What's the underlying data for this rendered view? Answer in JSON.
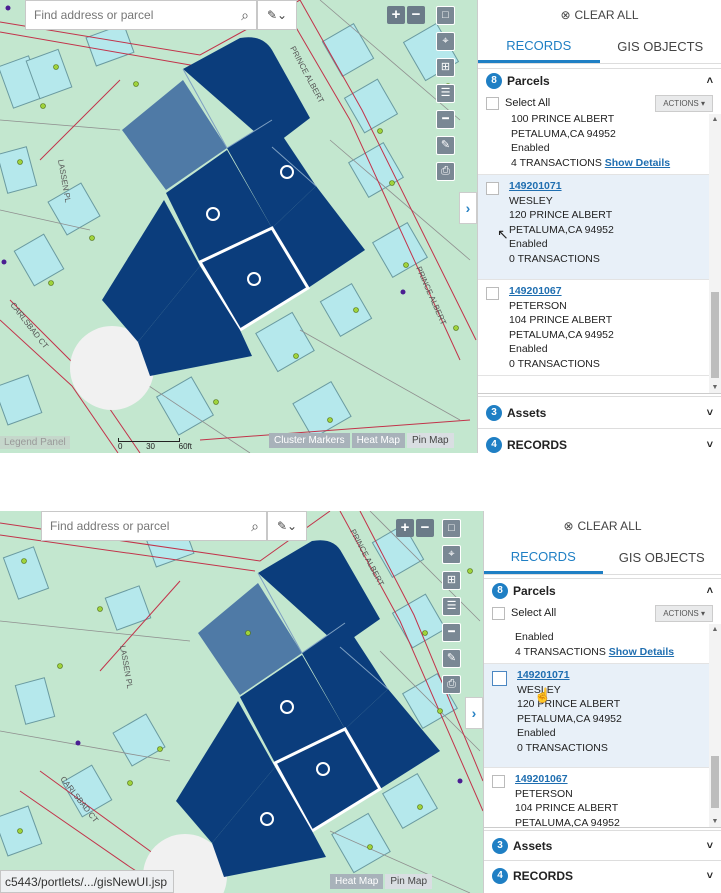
{
  "search": {
    "placeholder": "Find address or parcel"
  },
  "map": {
    "streets": [
      "LASSEN PL",
      "PRINCE ALBERT",
      "CARLSBAD CT"
    ],
    "legend_label": "Legend Panel",
    "scale": {
      "ticks": [
        "0",
        "30",
        "60ft"
      ]
    },
    "modes": [
      "Cluster Markers",
      "Heat Map",
      "Pin Map"
    ],
    "status_url": "c5443/portlets/.../gisNewUI.jsp"
  },
  "panel": {
    "clear_all": "CLEAR ALL",
    "tabs": [
      "RECORDS",
      "GIS OBJECTS"
    ],
    "parcels": {
      "count": "8",
      "label": "Parcels"
    },
    "select_all": "Select All",
    "actions": "ACTIONS",
    "assets": {
      "count": "3",
      "label": "Assets"
    },
    "records": {
      "count": "4",
      "label": "RECORDS"
    },
    "first_partial": {
      "address": "100 PRINCE ALBERT",
      "city": "PETALUMA,CA 94952",
      "status": "Enabled",
      "tx": "4 TRANSACTIONS",
      "details": "Show Details"
    },
    "items": [
      {
        "id": "149201071",
        "owner": "WESLEY",
        "address": "120 PRINCE ALBERT",
        "city": "PETALUMA,CA 94952",
        "status": "Enabled",
        "tx": "0 TRANSACTIONS"
      },
      {
        "id": "149201067",
        "owner": "PETERSON",
        "address": "104 PRINCE ALBERT",
        "city": "PETALUMA,CA 94952",
        "status": "Enabled",
        "tx": "0 TRANSACTIONS"
      }
    ]
  },
  "colors": {
    "accent": "#1f7fc4",
    "parcel_selected": "#0b3d7c",
    "parcel_light": "#4f7aa6",
    "map_green": "#c3e7cf",
    "building": "#b5e8ec",
    "road": "#c2334a"
  },
  "icons": [
    "search-icon",
    "draw-tool-icon",
    "zoom-in-icon",
    "zoom-out-icon",
    "fullscreen-icon",
    "locate-icon",
    "basemap-icon",
    "layers-icon",
    "measure-icon",
    "edit-icon",
    "print-icon",
    "collapse-arrow-icon",
    "clear-all-icon",
    "chevron-up-icon",
    "chevron-down-icon",
    "mouse-cursor-icon"
  ]
}
